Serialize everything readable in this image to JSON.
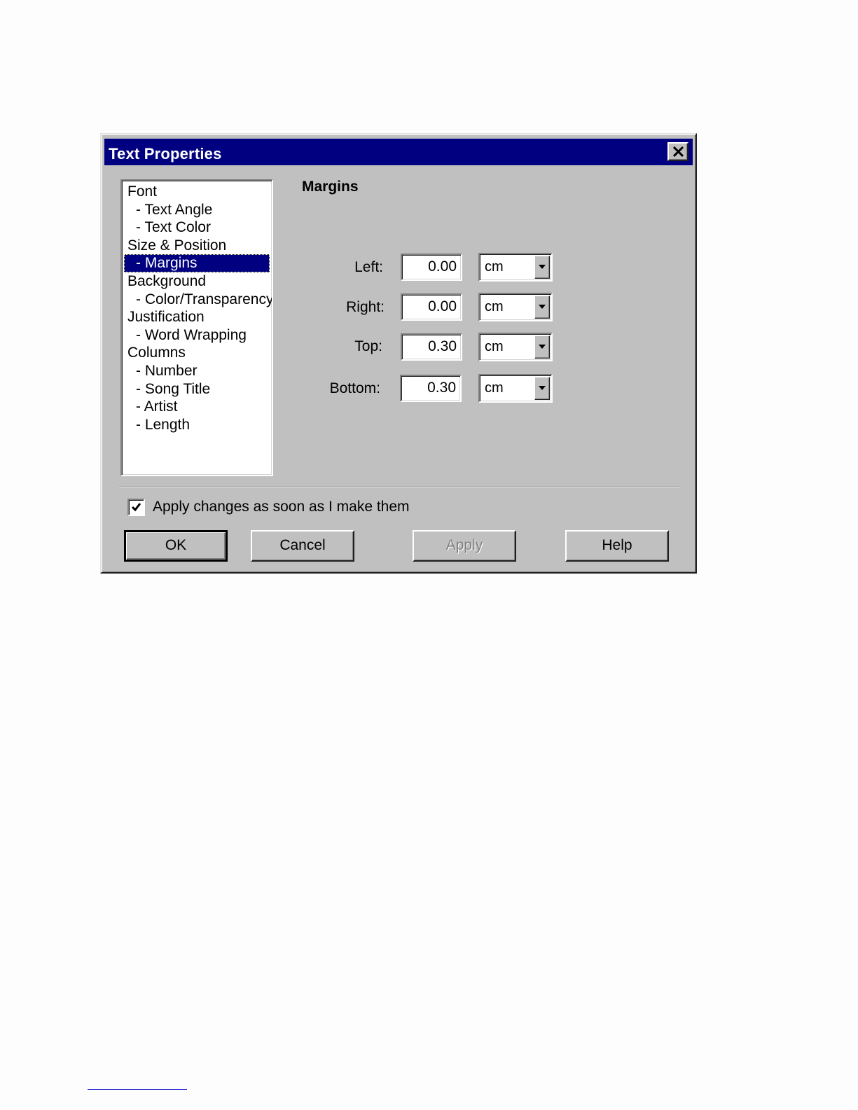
{
  "window": {
    "title": "Text Properties"
  },
  "sidebar": {
    "items": [
      {
        "label": "Font",
        "level": 0,
        "selected": false
      },
      {
        "label": "- Text Angle",
        "level": 1,
        "selected": false
      },
      {
        "label": "- Text Color",
        "level": 1,
        "selected": false
      },
      {
        "label": "Size & Position",
        "level": 0,
        "selected": false
      },
      {
        "label": "- Margins",
        "level": 1,
        "selected": true
      },
      {
        "label": "Background",
        "level": 0,
        "selected": false
      },
      {
        "label": "- Color/Transparency",
        "level": 1,
        "selected": false
      },
      {
        "label": "Justification",
        "level": 0,
        "selected": false
      },
      {
        "label": "- Word Wrapping",
        "level": 1,
        "selected": false
      },
      {
        "label": "Columns",
        "level": 0,
        "selected": false
      },
      {
        "label": "- Number",
        "level": 1,
        "selected": false
      },
      {
        "label": "- Song Title",
        "level": 1,
        "selected": false
      },
      {
        "label": "- Artist",
        "level": 1,
        "selected": false
      },
      {
        "label": "- Length",
        "level": 1,
        "selected": false
      }
    ]
  },
  "panel": {
    "title": "Margins",
    "fields": [
      {
        "label": "Left:",
        "value": "0.00",
        "unit": "cm"
      },
      {
        "label": "Right:",
        "value": "0.00",
        "unit": "cm"
      },
      {
        "label": "Top:",
        "value": "0.30",
        "unit": "cm"
      },
      {
        "label": "Bottom:",
        "value": "0.30",
        "unit": "cm"
      }
    ]
  },
  "apply_immediately": {
    "label": "Apply changes as soon as I make them",
    "checked": true
  },
  "buttons": {
    "ok": "OK",
    "cancel": "Cancel",
    "apply": "Apply",
    "help": "Help"
  },
  "colors": {
    "titlebar": "#000080",
    "face": "#c0c0c0",
    "selection": "#000080",
    "page": "#fdfdfd"
  }
}
